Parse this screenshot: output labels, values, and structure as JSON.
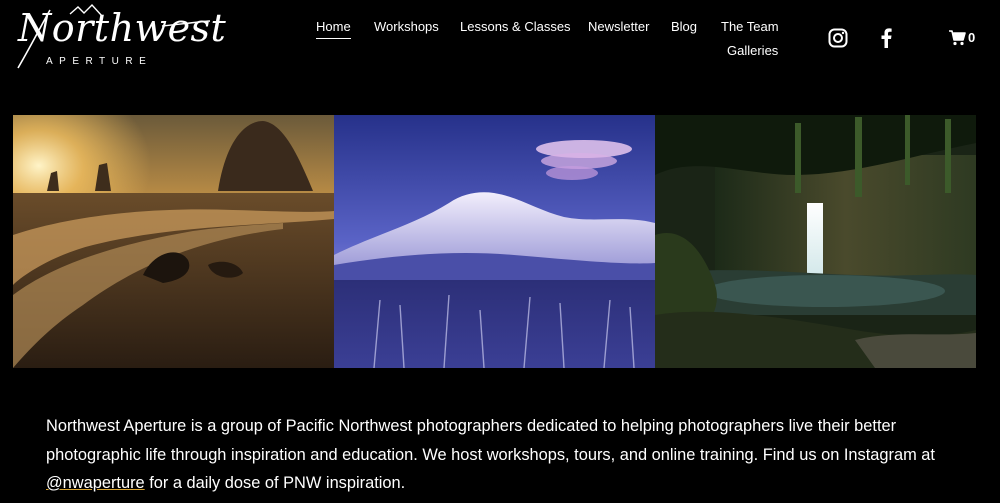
{
  "logo": {
    "name": "Northwest",
    "tagline": "APERTURE"
  },
  "nav": {
    "items": [
      {
        "label": "Home",
        "active": true
      },
      {
        "label": "Workshops",
        "active": false
      },
      {
        "label": "Lessons & Classes",
        "active": false
      },
      {
        "label": "Newsletter",
        "active": false
      },
      {
        "label": "Blog",
        "active": false
      },
      {
        "label": "The Team",
        "active": false
      },
      {
        "label": "Galleries",
        "active": false
      }
    ]
  },
  "social": {
    "instagram_icon": "instagram-icon",
    "facebook_icon": "facebook-icon"
  },
  "cart": {
    "icon": "cart-icon",
    "count": "0"
  },
  "gallery": {
    "photos": [
      {
        "subject": "haystack-rock-sunset-photo"
      },
      {
        "subject": "mount-st-helens-twilight-photo"
      },
      {
        "subject": "forest-waterfall-photo"
      }
    ]
  },
  "intro": {
    "text_before": "Northwest Aperture is a group of Pacific Northwest photographers dedicated to helping photographers live their better photographic life through inspiration and education. We host workshops, tours, and online training. Find us on Instagram at ",
    "link_text": "@nwaperture",
    "text_after": " for a daily dose of PNW inspiration."
  },
  "colors": {
    "background": "#000000",
    "text": "#ffffff",
    "link_underline": "#d9a431"
  }
}
